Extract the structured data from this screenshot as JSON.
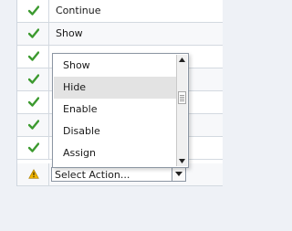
{
  "rows": [
    {
      "icon": "check-icon",
      "label": "Continue"
    },
    {
      "icon": "check-icon",
      "label": "Show"
    },
    {
      "icon": "check-icon",
      "label": ""
    },
    {
      "icon": "check-icon",
      "label": ""
    },
    {
      "icon": "check-icon",
      "label": ""
    },
    {
      "icon": "check-icon",
      "label": ""
    },
    {
      "icon": "check-icon",
      "label": ""
    },
    {
      "icon": "warning-icon",
      "label": ""
    }
  ],
  "select": {
    "value": "Select Action...",
    "options": [
      "Show",
      "Hide",
      "Enable",
      "Disable",
      "Assign"
    ],
    "hovered": "Hide"
  },
  "colors": {
    "check": "#3c9a2f",
    "warning": "#f0b400",
    "hover": "#e3e3e3",
    "background": "#eef1f6"
  }
}
